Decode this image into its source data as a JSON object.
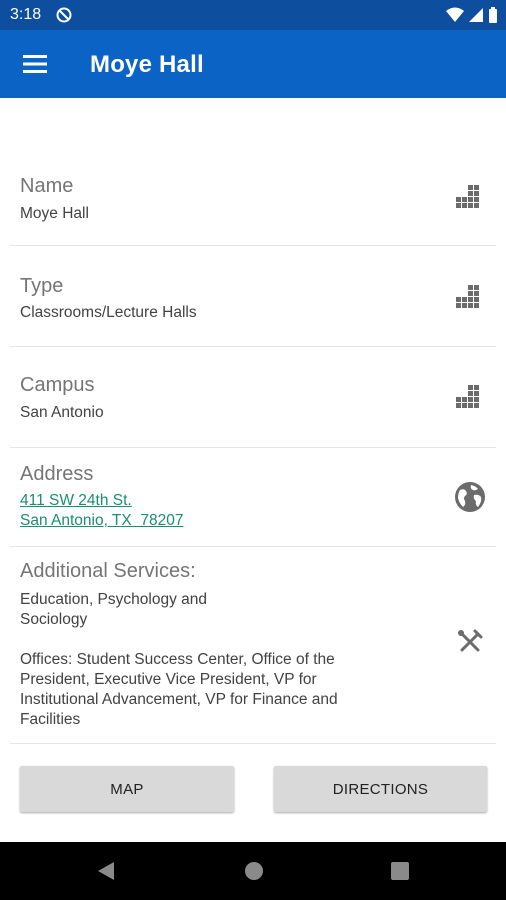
{
  "status_bar": {
    "time": "3:18"
  },
  "app_bar": {
    "title": "Moye Hall"
  },
  "details": {
    "name": {
      "label": "Name",
      "value": "Moye Hall"
    },
    "type": {
      "label": "Type",
      "value": "Classrooms/Lecture Halls"
    },
    "campus": {
      "label": "Campus",
      "value": "San Antonio"
    },
    "address": {
      "label": "Address",
      "line1": "411 SW 24th St.",
      "line2": "San Antonio, TX  78207"
    },
    "services": {
      "label": "Additional Services:",
      "line1": "Education, Psychology and",
      "line2": "Sociology",
      "offices_line1": "Offices: Student Success Center, Office of the",
      "offices_line2": "President, Executive Vice President, VP for",
      "offices_line3": "Institutional Advancement, VP for Finance and",
      "offices_line4": "Facilities"
    }
  },
  "buttons": {
    "map": "MAP",
    "directions": "DIRECTIONS"
  },
  "icons": {
    "building": "building-icon",
    "globe": "globe-icon",
    "tools": "tools-icon",
    "menu": "menu-icon"
  },
  "colors": {
    "status_bar": "#0d4f9e",
    "app_bar": "#0b63c5",
    "link": "#1a8f6d",
    "button": "#d9d9d9"
  }
}
